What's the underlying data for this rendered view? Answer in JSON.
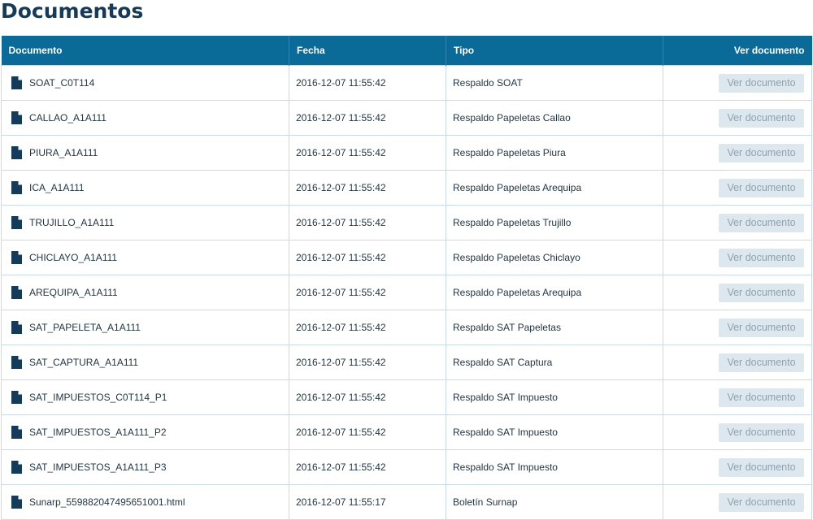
{
  "page": {
    "title": "Documentos"
  },
  "table": {
    "headers": {
      "documento": "Documento",
      "fecha": "Fecha",
      "tipo": "Tipo",
      "ver": "Ver documento"
    },
    "action_label": "Ver documento",
    "rows": [
      {
        "name": "SOAT_C0T114",
        "date": "2016-12-07 11:55:42",
        "type": "Respaldo SOAT"
      },
      {
        "name": "CALLAO_A1A111",
        "date": "2016-12-07 11:55:42",
        "type": "Respaldo Papeletas Callao"
      },
      {
        "name": "PIURA_A1A111",
        "date": "2016-12-07 11:55:42",
        "type": "Respaldo Papeletas Piura"
      },
      {
        "name": "ICA_A1A111",
        "date": "2016-12-07 11:55:42",
        "type": "Respaldo Papeletas Arequipa"
      },
      {
        "name": "TRUJILLO_A1A111",
        "date": "2016-12-07 11:55:42",
        "type": "Respaldo Papeletas Trujillo"
      },
      {
        "name": "CHICLAYO_A1A111",
        "date": "2016-12-07 11:55:42",
        "type": "Respaldo Papeletas Chiclayo"
      },
      {
        "name": "AREQUIPA_A1A111",
        "date": "2016-12-07 11:55:42",
        "type": "Respaldo Papeletas Arequipa"
      },
      {
        "name": "SAT_PAPELETA_A1A111",
        "date": "2016-12-07 11:55:42",
        "type": "Respaldo SAT Papeletas"
      },
      {
        "name": "SAT_CAPTURA_A1A111",
        "date": "2016-12-07 11:55:42",
        "type": "Respaldo SAT Captura"
      },
      {
        "name": "SAT_IMPUESTOS_C0T114_P1",
        "date": "2016-12-07 11:55:42",
        "type": "Respaldo SAT Impuesto"
      },
      {
        "name": "SAT_IMPUESTOS_A1A111_P2",
        "date": "2016-12-07 11:55:42",
        "type": "Respaldo SAT Impuesto"
      },
      {
        "name": "SAT_IMPUESTOS_A1A111_P3",
        "date": "2016-12-07 11:55:42",
        "type": "Respaldo SAT Impuesto"
      },
      {
        "name": "Sunarp_559882047495651001.html",
        "date": "2016-12-07 11:55:17",
        "type": "Boletín Surnap"
      }
    ]
  },
  "icons": {
    "file": "file-icon"
  },
  "colors": {
    "title": "#143b5a",
    "header_bg": "#0a6a98",
    "button_bg": "#dde7ee",
    "button_text": "#8ea2b0",
    "row_border": "#c8dbe8"
  }
}
